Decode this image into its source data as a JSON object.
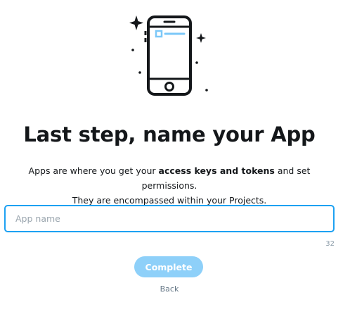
{
  "illustration": {
    "icon": "phone-icon",
    "accent_color": "#7cc8f8"
  },
  "title": "Last step, name your App",
  "description": {
    "line1_pre": "Apps are where you get your ",
    "line1_bold": "access keys and tokens",
    "line1_post": " and set permissions.",
    "line2": "They are encompassed within your Projects."
  },
  "app_name_input": {
    "value": "",
    "placeholder": "App name",
    "max_length": 32
  },
  "counter": "32",
  "complete_button": {
    "label": "Complete",
    "color": "#8ed0f9"
  },
  "back_link": "Back",
  "colors": {
    "accent": "#1da1f2",
    "text": "#14171a",
    "muted": "#657786"
  }
}
